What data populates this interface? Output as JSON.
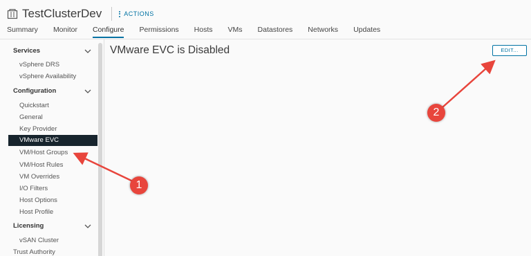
{
  "header": {
    "title": "TestClusterDev",
    "actions_label": "ACTIONS",
    "tabs": [
      {
        "label": "Summary"
      },
      {
        "label": "Monitor"
      },
      {
        "label": "Configure",
        "active": true
      },
      {
        "label": "Permissions"
      },
      {
        "label": "Hosts"
      },
      {
        "label": "VMs"
      },
      {
        "label": "Datastores"
      },
      {
        "label": "Networks"
      },
      {
        "label": "Updates"
      }
    ]
  },
  "sidebar": {
    "services": {
      "label": "Services",
      "items": [
        "vSphere DRS",
        "vSphere Availability"
      ]
    },
    "configuration": {
      "label": "Configuration",
      "items": [
        "Quickstart",
        "General",
        "Key Provider",
        "VMware EVC",
        "VM/Host Groups",
        "VM/Host Rules",
        "VM Overrides",
        "I/O Filters",
        "Host Options",
        "Host Profile"
      ]
    },
    "licensing": {
      "label": "Licensing",
      "items": [
        "vSAN Cluster"
      ]
    },
    "trust_authority": "Trust Authority",
    "selected": "VMware EVC"
  },
  "main": {
    "title": "VMware EVC is Disabled",
    "edit_label": "EDIT..."
  },
  "annotations": {
    "badge1": "1",
    "badge2": "2",
    "color": "#e8453c"
  },
  "colors": {
    "accent": "#0072a3",
    "selected_bg": "#17242d"
  }
}
